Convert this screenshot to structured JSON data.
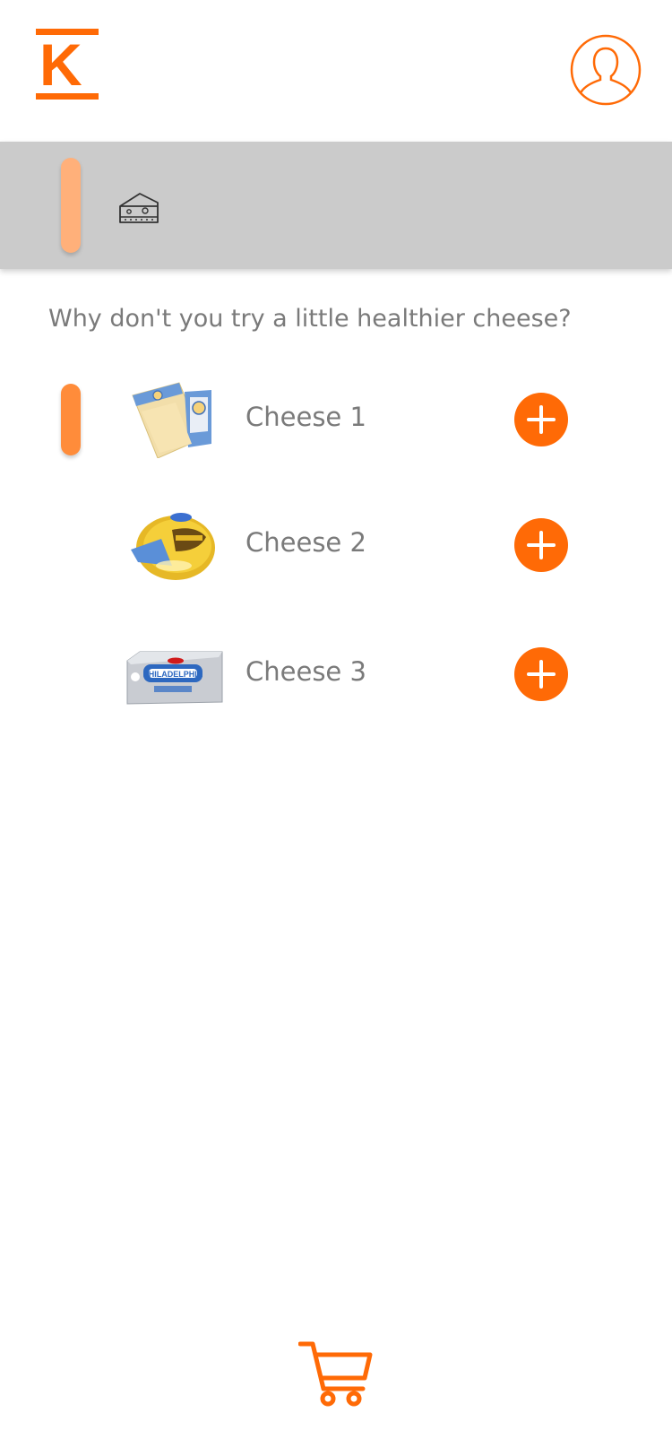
{
  "header": {
    "logo_letter": "K",
    "profile_icon": "user-avatar-icon"
  },
  "category": {
    "icon": "cheese-icon"
  },
  "suggestion_text": "Why don't you try a little healthier cheese?",
  "items": [
    {
      "name": "Cheese 1",
      "image": "cheese-block-image",
      "selected": true
    },
    {
      "name": "Cheese 2",
      "image": "cheese-tub-image",
      "selected": false
    },
    {
      "name": "Cheese 3",
      "image": "cream-cheese-image",
      "selected": false
    }
  ],
  "footer": {
    "cart_icon": "cart-icon"
  },
  "colors": {
    "accent": "#ff6a06",
    "indicator": "#ff8c3a",
    "indicator_light": "#ffb07a",
    "category_bg": "#cbcbcb",
    "text": "#7a7a7a"
  }
}
